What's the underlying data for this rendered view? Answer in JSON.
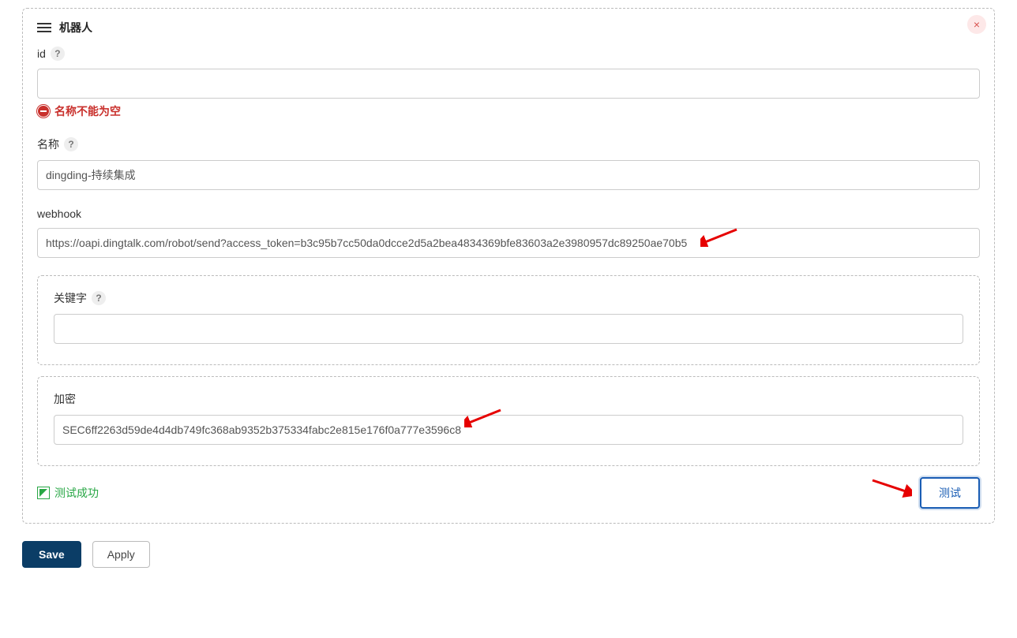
{
  "panel": {
    "title": "机器人",
    "close": "×"
  },
  "fields": {
    "id": {
      "label": "id",
      "help": "?",
      "value": "",
      "error": "名称不能为空"
    },
    "name": {
      "label": "名称",
      "help": "?",
      "value": "dingding-持续集成"
    },
    "webhook": {
      "label": "webhook",
      "value": "https://oapi.dingtalk.com/robot/send?access_token=b3c95b7cc50da0dcce2d5a2bea4834369bfe83603a2e3980957dc89250ae70b5"
    },
    "keyword": {
      "label": "关键字",
      "help": "?",
      "value": ""
    },
    "secret": {
      "label": "加密",
      "value": "SEC6ff2263d59de4d4db749fc368ab9352b375334fabc2e815e176f0a777e3596c8"
    }
  },
  "status": {
    "success": "测试成功"
  },
  "buttons": {
    "test": "测试",
    "save": "Save",
    "apply": "Apply"
  }
}
